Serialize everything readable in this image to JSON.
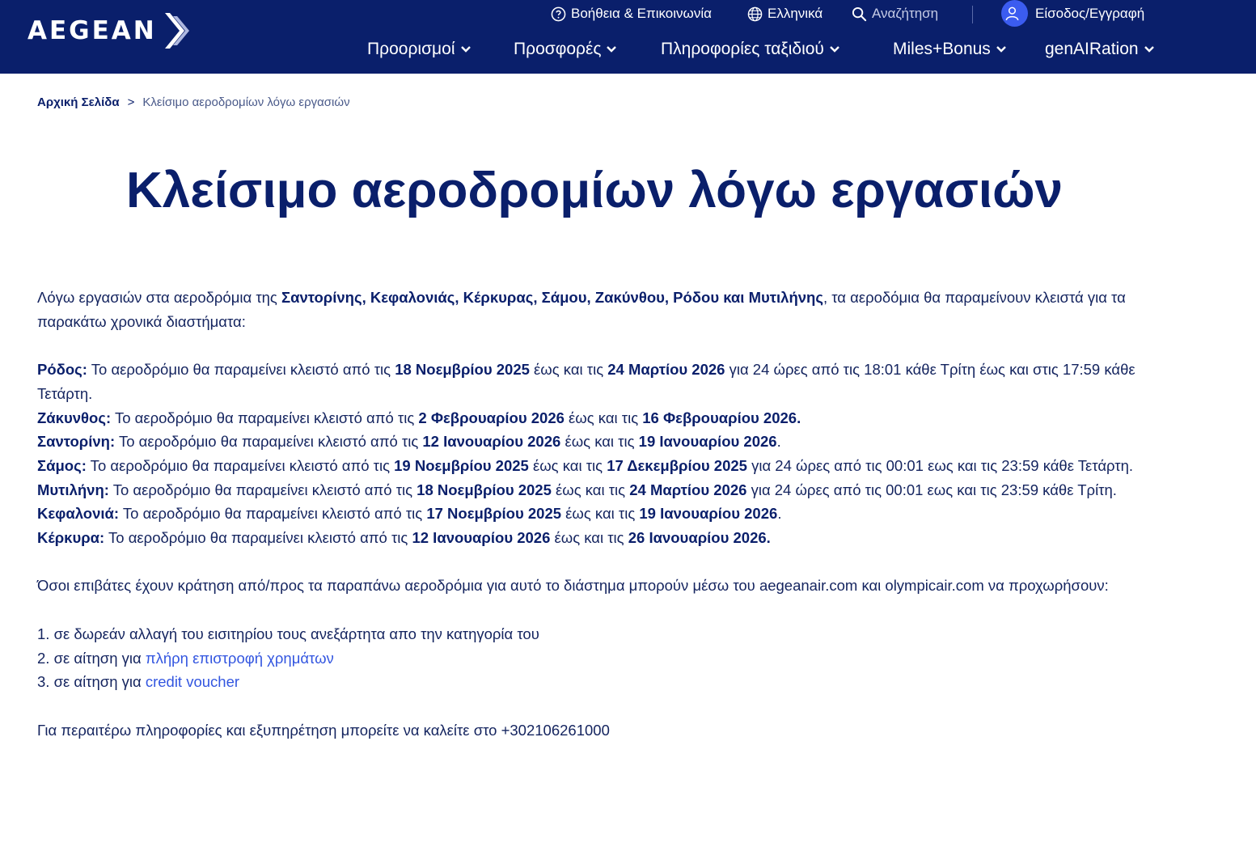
{
  "header": {
    "logo_text": "AEGEAN",
    "utility": {
      "help": "Βοήθεια & Επικοινωνία",
      "language": "Ελληνικά",
      "search_placeholder": "Αναζήτηση",
      "login": "Είσοδος/Εγγραφή"
    },
    "nav": [
      "Προορισμοί",
      "Προσφορές",
      "Πληροφορίες ταξιδιού",
      "Miles+Bonus",
      "genAIRation"
    ],
    "icons": {
      "help": "question-circle-icon",
      "language": "globe-icon",
      "search": "search-icon",
      "login": "user-icon",
      "dropdown": "chevron-down-icon"
    }
  },
  "breadcrumb": {
    "home": "Αρχική Σελίδα",
    "separator": ">",
    "current": "Κλείσιμο αεροδρομίων λόγω εργασιών"
  },
  "page_title": "Κλείσιμο αεροδρομίων λόγω εργασιών",
  "intro": {
    "pre": "Λόγω εργασιών στα αεροδρόμια της ",
    "bold": "Σαντορίνης, Κεφαλονιάς, Κέρκυρας, Σάμου, Ζακύνθου, Ρόδου και Μυτιλήνης",
    "post": ", τα αεροδόμια θα παραμείνουν κλειστά για τα παρακάτω χρονικά διαστήματα:"
  },
  "closures": [
    {
      "airport": "Ρόδος:",
      "text": " Το αεροδρόμιο θα παραμείνει κλειστό από τις ",
      "from": "18 Νοεμβρίου 2025",
      "mid": " έως και τις ",
      "to": "24 Μαρτίου 2026",
      "tail": " για 24 ώρες από τις 18:01 κάθε Τρίτη έως και στις 17:59 κάθε Τετάρτη."
    },
    {
      "airport": "Ζάκυνθος:",
      "text": " Το αεροδρόμιο θα παραμείνει κλειστό από τις ",
      "from": "2 Φεβρουαρίου 2026",
      "mid": " έως και τις ",
      "to": "16 Φεβρουαρίου 2026.",
      "tail": ""
    },
    {
      "airport": "Σαντορίνη:",
      "text": " Το αεροδρόμιο θα παραμείνει κλειστό από τις ",
      "from": "12 Ιανουαρίου 2026",
      "mid": " έως και τις ",
      "to": "19 Ιανουαρίου 2026",
      "tail": "."
    },
    {
      "airport": "Σάμος:",
      "text": " Το αεροδρόμιο θα παραμείνει κλειστό από τις ",
      "from": "19 Νοεμβρίου 2025",
      "mid": " έως και τις ",
      "to": "17 Δεκεμβρίου 2025",
      "tail": " για 24 ώρες από τις 00:01 εως και τις 23:59 κάθε Τετάρτη."
    },
    {
      "airport": "Μυτιλήνη:",
      "text": " Το αεροδρόμιο θα παραμείνει κλειστό από τις ",
      "from": "18 Νοεμβρίου 2025",
      "mid": " έως και τις ",
      "to": "24 Μαρτίου 2026",
      "tail": " για 24 ώρες από τις 00:01 εως και τις 23:59 κάθε Τρίτη."
    },
    {
      "airport": "Κεφαλονιά:",
      "text": " Το αεροδρόμιο θα παραμείνει κλειστό από τις ",
      "from": "17 Νοεμβρίου 2025",
      "mid": " έως και τις ",
      "to": "19 Ιανουαρίου 2026",
      "tail": "."
    },
    {
      "airport": "Κέρκυρα:",
      "text": " Το αεροδρόμιο θα παραμείνει κλειστό από τις ",
      "from": "12 Ιανουαρίου 2026",
      "mid": " έως και τις ",
      "to": "26 Ιανουαρίου 2026.",
      "tail": ""
    }
  ],
  "passengers_note": "Όσοι επιβάτες έχουν κράτηση από/προς τα παραπάνω αεροδρόμια για αυτό το διάστημα μπορούν μέσω του aegeanair.com και olympicair.com να προχωρήσουν:",
  "options": [
    {
      "prefix": "1. σε δωρεάν αλλαγή του εισιτηρίου τους ανεξάρτητα απο την κατηγορία του",
      "link": ""
    },
    {
      "prefix": "2. σε αίτηση για ",
      "link": "πλήρη επιστροφή χρημάτων"
    },
    {
      "prefix": "3. σε αίτηση για ",
      "link": "credit voucher"
    }
  ],
  "contact": "Για περαιτέρω πληροφορίες και εξυπηρέτηση μπορείτε να καλείτε στο +302106261000",
  "colors": {
    "header_bg": "#0a1f6b",
    "text": "#0a1f6b",
    "link": "#3356e0",
    "avatar": "#3b5cf0"
  }
}
